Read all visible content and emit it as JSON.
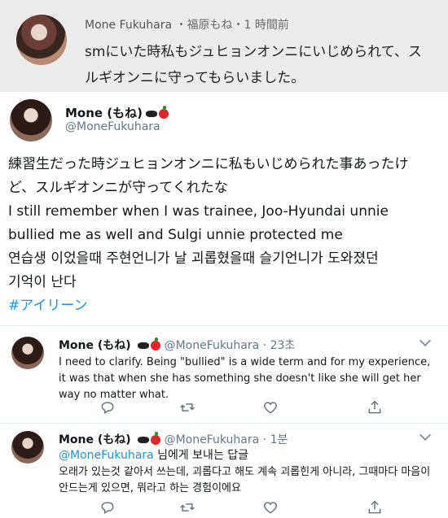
{
  "top_card": {
    "name": "Mone Fukuhara",
    "meta": " ・福原もね・1 時間前",
    "text": "smにいた時私もジュヒョンオンニにいじめられて、スルギオンニに守ってもらいました。"
  },
  "main_tweet": {
    "name": "Mone (もね)",
    "handle": "@MoneFukuhara",
    "lines": [
      "練習生だった時ジュヒョンオンニに私もいじめられた事あったけ",
      "ど、スルギオンニが守ってくれたな",
      "I still remember when I was trainee, Joo-Hyundai unnie",
      "bullied me as well and Sulgi unnie protected me",
      "연습생 이었을때 주현언니가 날 괴롭혔을때 슬기언니가 도와졌던",
      "기억이 난다"
    ],
    "hashtag": "#アイリーン"
  },
  "reply1": {
    "name": "Mone (もね)",
    "handle_time": "@MoneFukuhara · 23초",
    "text": "I need to clarify. Being \"bullied\" is a wide term and for my experience, it was that when she has something she doesn't like she will get her way no matter what."
  },
  "reply2": {
    "name": "Mone (もね)",
    "handle_time": "@MoneFukuhara · 1분",
    "mention": "@MoneFukuhara",
    "reply_to": " 님에게 보내는 답글",
    "text": "오래가 있는것 같아서 쓰는데, 괴롭다고 해도 계속 괴롭힌게 아니라, 그때마다 마음이 안드는게 있으면, 뭐라고 하는 경험이에요"
  },
  "icons": [
    "reply-icon",
    "retweet-icon",
    "like-icon",
    "share-icon",
    "chevron-down-icon"
  ],
  "colors": {
    "link": "#1b95e0",
    "muted": "#657786",
    "top_card_bg": "#ececec"
  }
}
